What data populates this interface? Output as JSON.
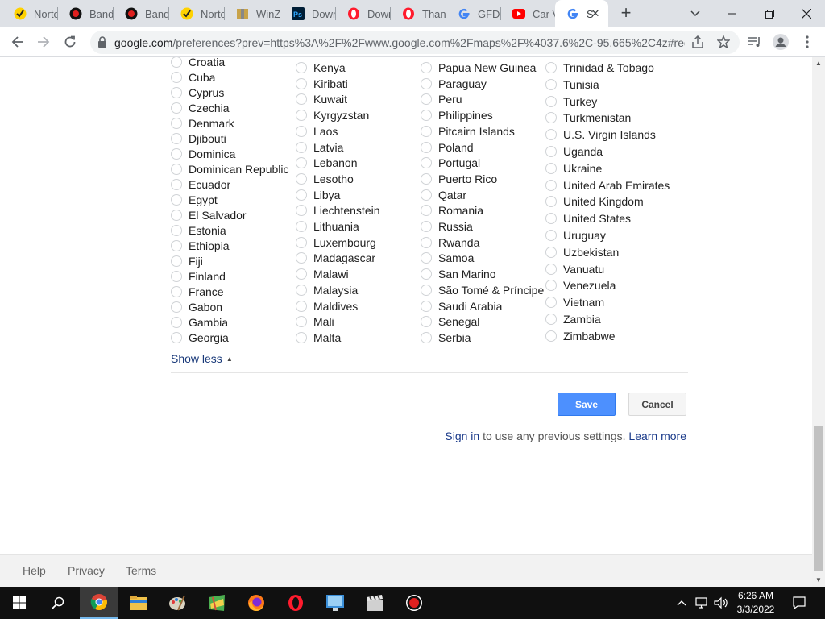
{
  "browser": {
    "tabs": [
      {
        "label": "Norto",
        "icon": "norton-icon"
      },
      {
        "label": "Band",
        "icon": "bandicam-icon"
      },
      {
        "label": "Band",
        "icon": "bandicam-icon"
      },
      {
        "label": "Norto",
        "icon": "norton-icon"
      },
      {
        "label": "WinZ",
        "icon": "winzip-icon"
      },
      {
        "label": "Down",
        "icon": "photoshop-icon"
      },
      {
        "label": "Down",
        "icon": "opera-icon"
      },
      {
        "label": "Than",
        "icon": "opera-icon"
      },
      {
        "label": "GFDC",
        "icon": "google-icon"
      },
      {
        "label": "Car V",
        "icon": "youtube-icon"
      },
      {
        "label": "S",
        "icon": "google-icon",
        "active": true
      }
    ],
    "url_host": "google.com",
    "url_rest": "/preferences?prev=https%3A%2F%2Fwww.google.com%2Fmaps%2F%4037.6%2C-95.665%2C4z#reg..."
  },
  "regions": {
    "col1": [
      "Croatia",
      "Cuba",
      "Cyprus",
      "Czechia",
      "Denmark",
      "Djibouti",
      "Dominica",
      "Dominican Republic",
      "Ecuador",
      "Egypt",
      "El Salvador",
      "Estonia",
      "Ethiopia",
      "Fiji",
      "Finland",
      "France",
      "Gabon",
      "Gambia",
      "Georgia"
    ],
    "col2": [
      "Kenya",
      "Kiribati",
      "Kuwait",
      "Kyrgyzstan",
      "Laos",
      "Latvia",
      "Lebanon",
      "Lesotho",
      "Libya",
      "Liechtenstein",
      "Lithuania",
      "Luxembourg",
      "Madagascar",
      "Malawi",
      "Malaysia",
      "Maldives",
      "Mali",
      "Malta"
    ],
    "col3": [
      "Papua New Guinea",
      "Paraguay",
      "Peru",
      "Philippines",
      "Pitcairn Islands",
      "Poland",
      "Portugal",
      "Puerto Rico",
      "Qatar",
      "Romania",
      "Russia",
      "Rwanda",
      "Samoa",
      "San Marino",
      "São Tomé & Príncipe",
      "Saudi Arabia",
      "Senegal",
      "Serbia"
    ],
    "col4": [
      "Trinidad & Tobago",
      "Tunisia",
      "Turkey",
      "Turkmenistan",
      "U.S. Virgin Islands",
      "Uganda",
      "Ukraine",
      "United Arab Emirates",
      "United Kingdom",
      "United States",
      "Uruguay",
      "Uzbekistan",
      "Vanuatu",
      "Venezuela",
      "Vietnam",
      "Zambia",
      "Zimbabwe"
    ]
  },
  "show_less": "Show less",
  "buttons": {
    "save": "Save",
    "cancel": "Cancel"
  },
  "signin": {
    "link": "Sign in",
    "text": " to use any previous settings. ",
    "learn_more": "Learn more"
  },
  "footer": {
    "help": "Help",
    "privacy": "Privacy",
    "terms": "Terms"
  },
  "clock": {
    "time": "6:26 AM",
    "date": "3/3/2022"
  },
  "colors": {
    "save_button": "#4d90fe",
    "link": "#1a3a8a"
  }
}
